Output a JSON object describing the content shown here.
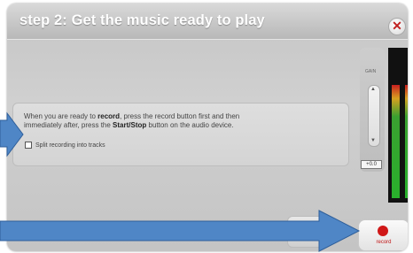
{
  "dialog": {
    "title": "step 2: Get the music ready to play",
    "close_icon": "close-icon"
  },
  "instructions": {
    "line1_pre": "When you are ready to ",
    "line1_bold": "record",
    "line1_post": ", press the record button first and then",
    "line2_pre": "immediately after, press the ",
    "line2_bold": "Start/Stop",
    "line2_post": " button on the audio device."
  },
  "split_checkbox": {
    "label": "Split recording into tracks",
    "checked": false
  },
  "gain": {
    "label": "GAIN",
    "value": "+0.0"
  },
  "record_button": {
    "label": "record",
    "color": "#d01818"
  },
  "colors": {
    "accent_arrow": "#4f86c6",
    "meter_green": "#29b02c"
  }
}
